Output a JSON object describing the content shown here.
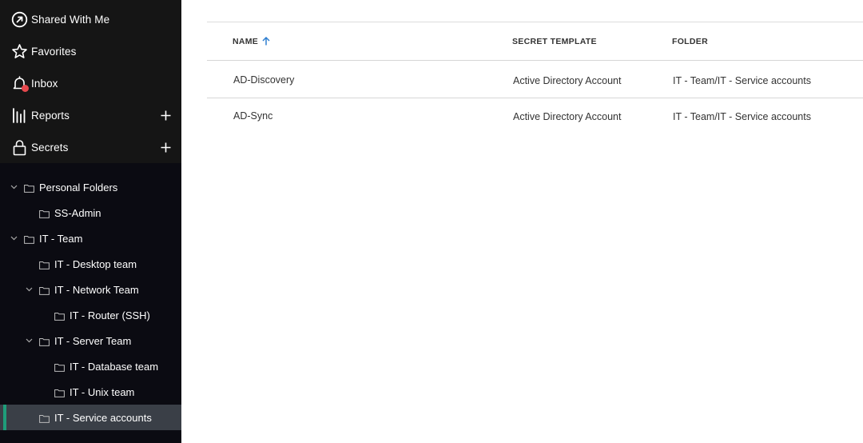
{
  "sidebar": {
    "nav": [
      {
        "label": "Shared With Me",
        "icon": "arrow-up-right-circle-icon"
      },
      {
        "label": "Favorites",
        "icon": "star-icon"
      },
      {
        "label": "Inbox",
        "icon": "bell-icon",
        "has_notification": true
      },
      {
        "label": "Reports",
        "icon": "bar-chart-icon",
        "add": true
      },
      {
        "label": "Secrets",
        "icon": "lock-icon",
        "add": true
      }
    ],
    "tree": [
      {
        "label": "Personal Folders",
        "level": 0,
        "expanded": true
      },
      {
        "label": "SS-Admin",
        "level": 1
      },
      {
        "label": "IT - Team",
        "level": 0,
        "expanded": true
      },
      {
        "label": "IT - Desktop team",
        "level": 1
      },
      {
        "label": "IT - Network Team",
        "level": 1,
        "expanded": true
      },
      {
        "label": "IT - Router (SSH)",
        "level": 2
      },
      {
        "label": "IT - Server Team",
        "level": 1,
        "expanded": true
      },
      {
        "label": "IT - Database team",
        "level": 2
      },
      {
        "label": "IT - Unix team",
        "level": 2
      },
      {
        "label": "IT - Service accounts",
        "level": 1,
        "selected": true
      }
    ]
  },
  "table": {
    "columns": [
      "NAME",
      "SECRET TEMPLATE",
      "FOLDER"
    ],
    "sort": {
      "column": "NAME",
      "direction": "ascending"
    },
    "rows": [
      {
        "name": "AD-Discovery",
        "template": "Active Directory Account",
        "folder": "IT - Team/IT - Service accounts"
      },
      {
        "name": "AD-Sync",
        "template": "Active Directory Account",
        "folder": "IT - Team/IT - Service accounts"
      }
    ]
  },
  "colors": {
    "sidebar_bg": "#0b0b12",
    "nav_bg": "#151515",
    "selected_bg": "#3a3f47",
    "selected_accent": "#1f9d7a",
    "notification": "#e5484d",
    "sort_arrow": "#2f7fd1"
  }
}
